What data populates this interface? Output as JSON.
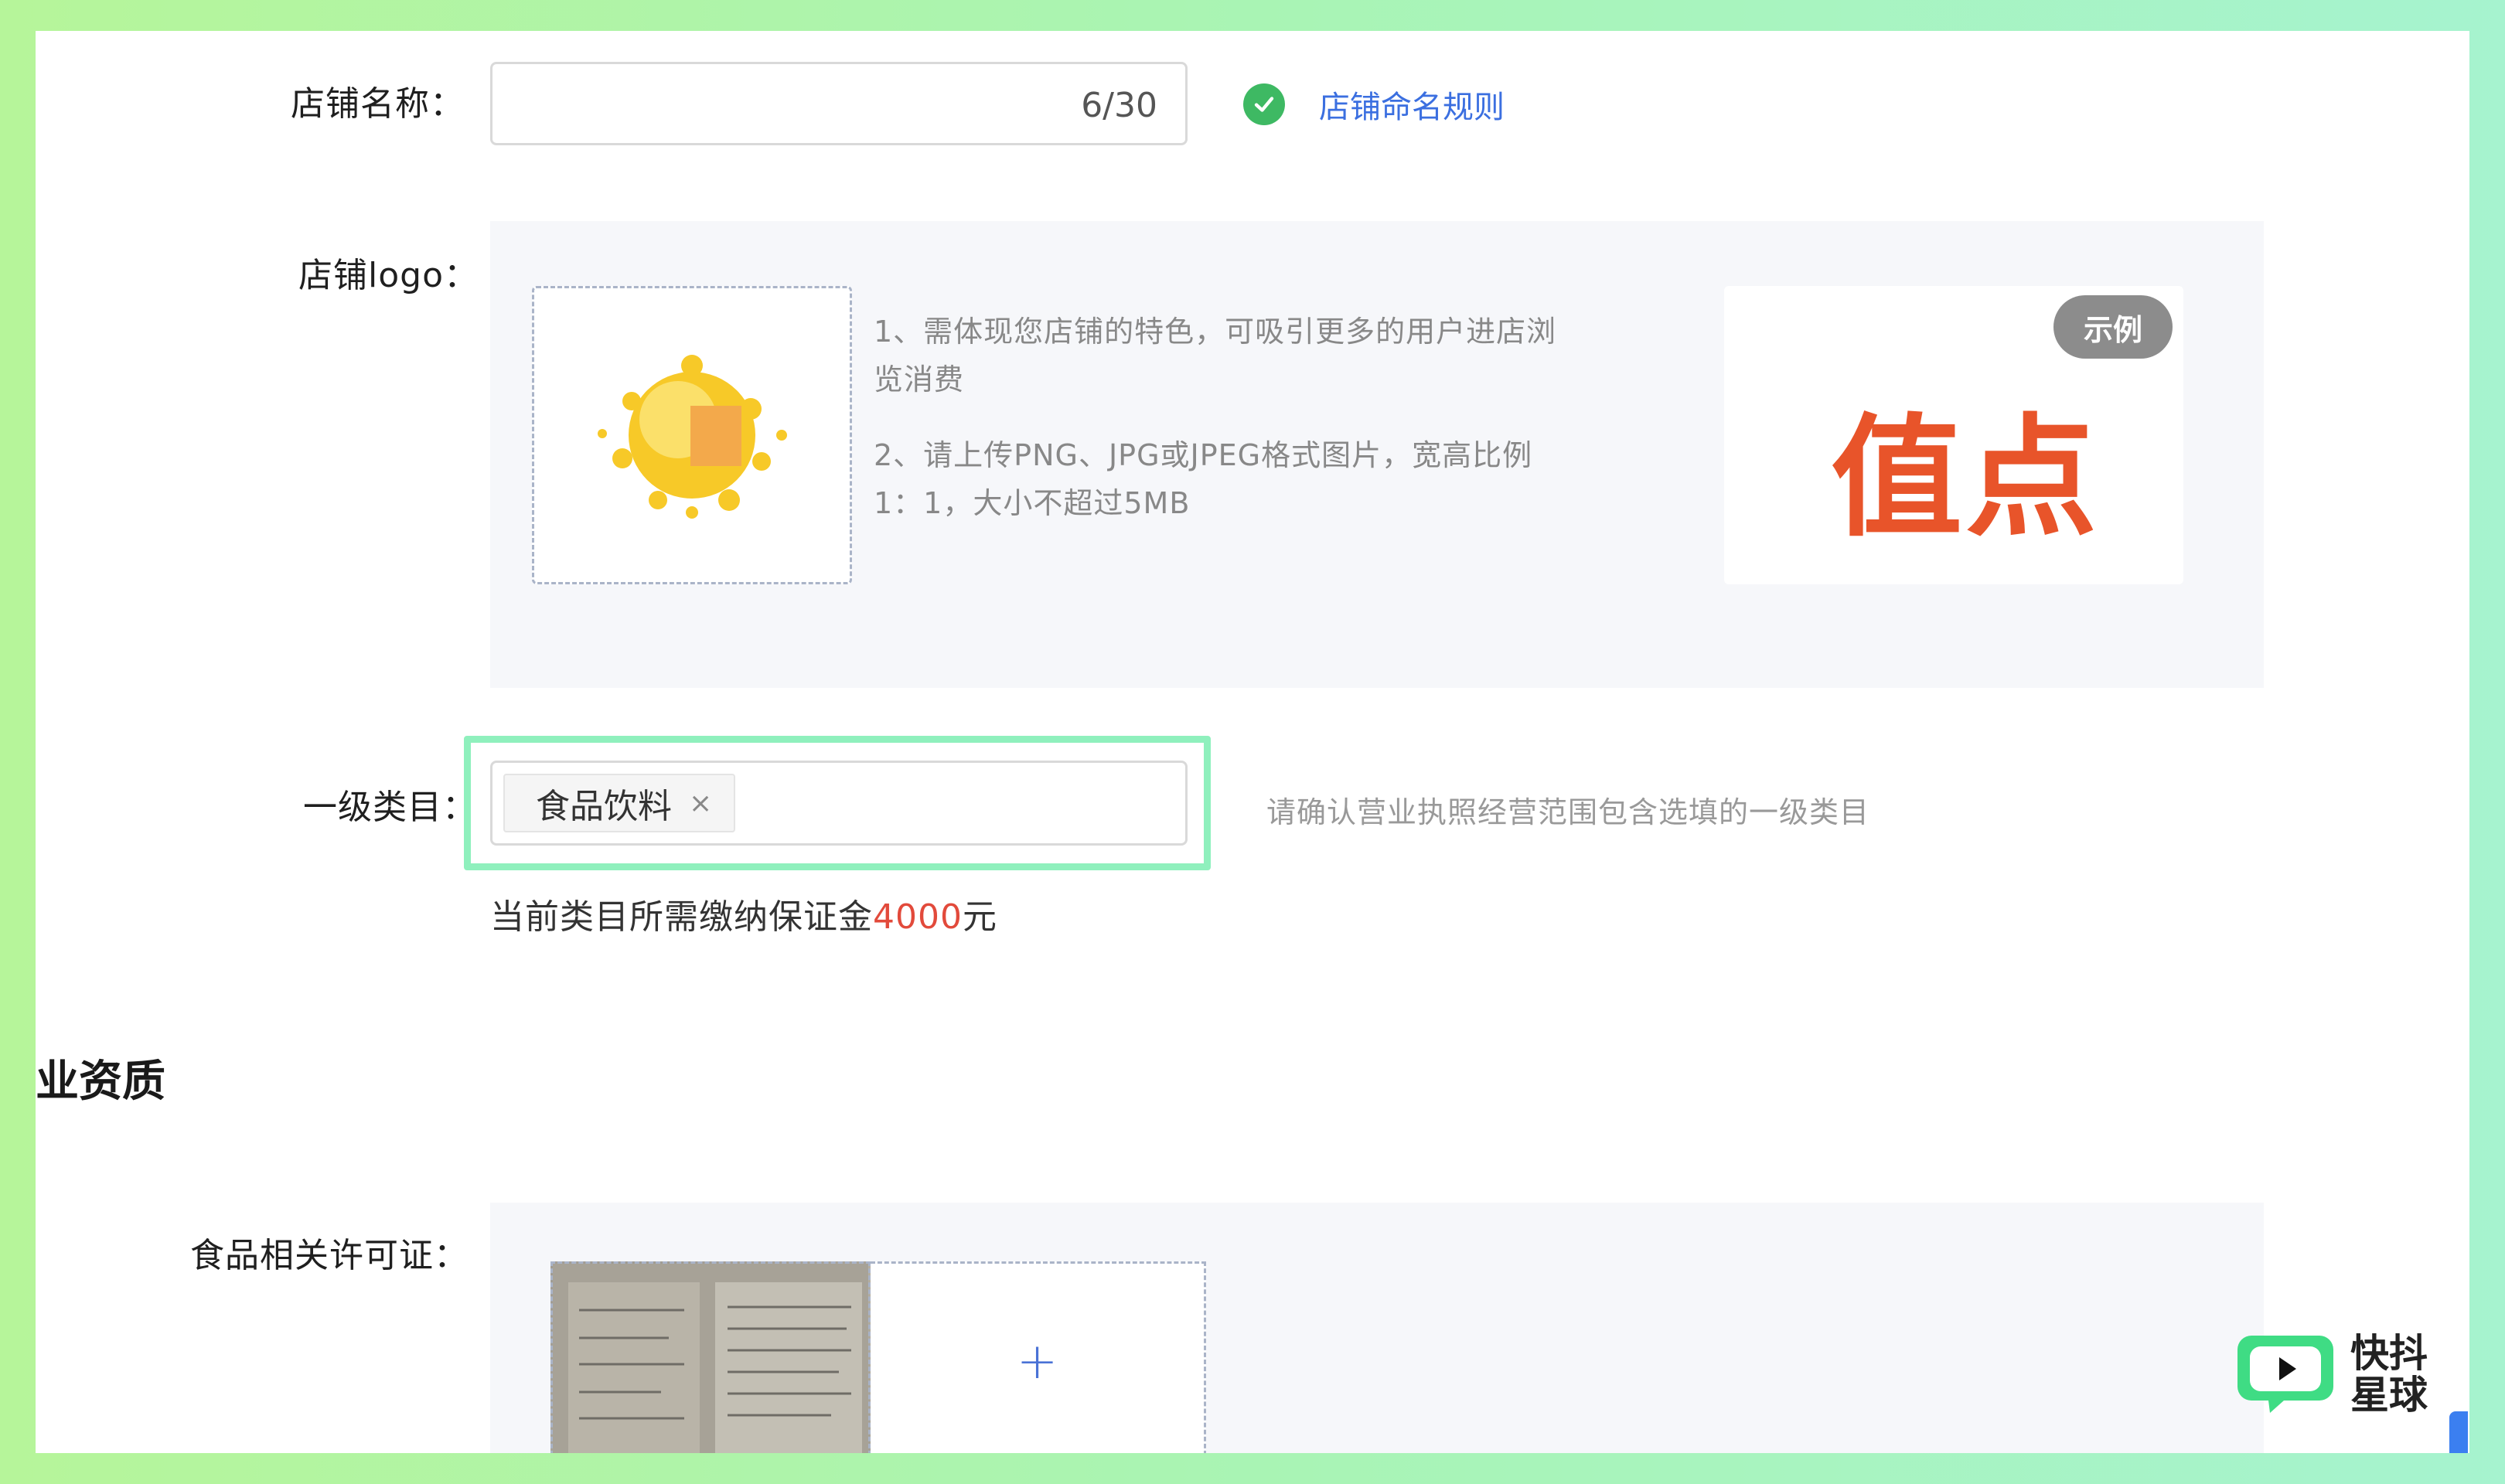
{
  "store_name": {
    "label": "店铺名称：",
    "value": "",
    "counter": "6/30",
    "rule_link": "店铺命名规则"
  },
  "store_logo": {
    "label": "店铺logo：",
    "tip1_line1": "1、需体现您店铺的特色，可吸引更多的用户进店浏",
    "tip1_line2": "览消费",
    "tip2_line1": "2、请上传PNG、JPG或JPEG格式图片，宽高比例",
    "tip2_line2": "1：1，大小不超过5MB",
    "example_badge": "示例",
    "example_logo_text": "值点"
  },
  "category": {
    "label": "一级类目：",
    "selected_tag": "食品饮料",
    "remove_glyph": "×",
    "hint": "请确认营业执照经营范围包含选填的一级类目",
    "deposit_prefix": "当前类目所需缴纳保证金",
    "deposit_amount": "4000",
    "deposit_suffix": "元"
  },
  "section": {
    "title": "业资质"
  },
  "license": {
    "label": "食品相关许可证：",
    "add_glyph": "+"
  },
  "watermark": {
    "line1": "快抖",
    "line2": "星球"
  },
  "colors": {
    "accent": "#3b6fe0",
    "success": "#3eb963",
    "highlight": "#8ff0bd",
    "amount": "#e24a3b",
    "example_logo": "#e8542a"
  }
}
